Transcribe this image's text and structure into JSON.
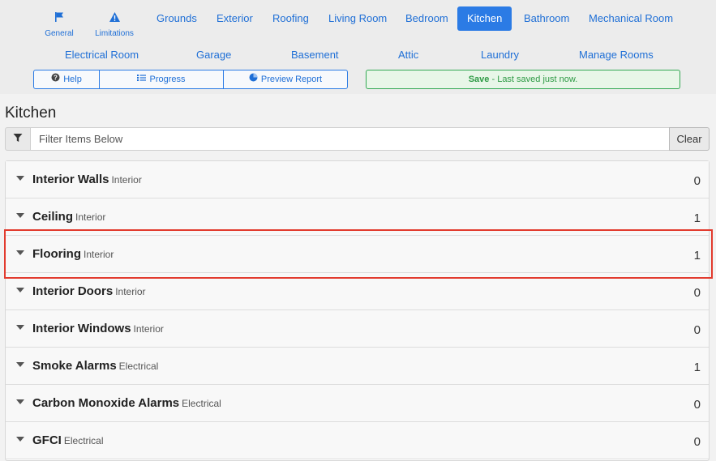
{
  "nav": {
    "icon_tabs": [
      {
        "label": "General",
        "icon": "flag-icon"
      },
      {
        "label": "Limitations",
        "icon": "warning-icon"
      }
    ],
    "tabs": [
      "Grounds",
      "Exterior",
      "Roofing",
      "Living Room",
      "Bedroom",
      "Kitchen",
      "Bathroom",
      "Mechanical Room"
    ],
    "active_tab": "Kitchen",
    "tabs_row2": [
      "Electrical Room",
      "Garage",
      "Basement",
      "Attic",
      "Laundry",
      "Manage Rooms"
    ]
  },
  "toolbar": {
    "help_label": "Help",
    "progress_label": "Progress",
    "preview_label": "Preview Report",
    "save_strong": "Save",
    "save_status": " - Last saved just now."
  },
  "page": {
    "title": "Kitchen"
  },
  "filter": {
    "placeholder": "Filter Items Below",
    "value": "",
    "clear_label": "Clear"
  },
  "items": [
    {
      "name": "Interior Walls",
      "category": "Interior",
      "count": "0"
    },
    {
      "name": "Ceiling",
      "category": "Interior",
      "count": "1"
    },
    {
      "name": "Flooring",
      "category": "Interior",
      "count": "1"
    },
    {
      "name": "Interior Doors",
      "category": "Interior",
      "count": "0"
    },
    {
      "name": "Interior Windows",
      "category": "Interior",
      "count": "0"
    },
    {
      "name": "Smoke Alarms",
      "category": "Electrical",
      "count": "1"
    },
    {
      "name": "Carbon Monoxide Alarms",
      "category": "Electrical",
      "count": "0"
    },
    {
      "name": "GFCI",
      "category": "Electrical",
      "count": "0"
    }
  ],
  "colors": {
    "accent": "#2b7be5",
    "success": "#33a853",
    "highlight": "#e23b2e"
  }
}
